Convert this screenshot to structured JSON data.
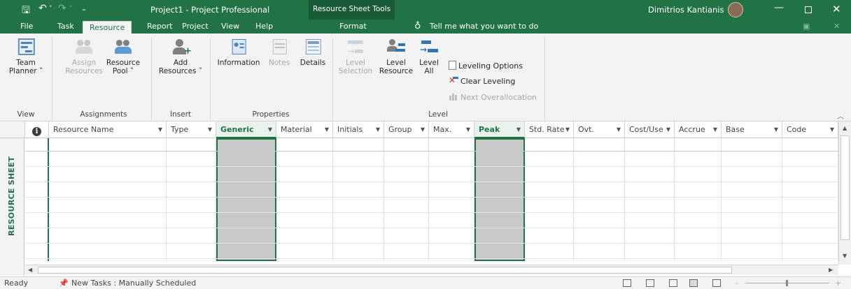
{
  "window": {
    "title": "Project1  -  Project Professional",
    "context_tab_group": "Resource Sheet Tools",
    "user_name": "Dimitrios Kantianis"
  },
  "tabs": [
    "File",
    "Task",
    "Resource",
    "Report",
    "Project",
    "View",
    "Help",
    "Format"
  ],
  "active_tab": "Resource",
  "tell_me": "Tell me what you want to do",
  "ribbon": {
    "view": {
      "team_planner": "Team",
      "team_planner_2": "Planner ˅",
      "label": "View"
    },
    "assignments": {
      "assign": "Assign",
      "assign_2": "Resources",
      "pool": "Resource",
      "pool_2": "Pool ˅",
      "label": "Assignments"
    },
    "insert": {
      "add": "Add",
      "add_2": "Resources ˅",
      "label": "Insert"
    },
    "properties": {
      "information": "Information",
      "notes": "Notes",
      "details": "Details",
      "label": "Properties"
    },
    "level": {
      "selection": "Level",
      "selection_2": "Selection",
      "resource": "Level",
      "resource_2": "Resource",
      "all": "Level",
      "all_2": "All",
      "options": "Leveling Options",
      "clear": "Clear Leveling",
      "next": "Next Overallocation",
      "label": "Level"
    }
  },
  "side_label": "RESOURCE SHEET",
  "columns": [
    "Resource Name",
    "Type",
    "Generic",
    "Material",
    "Initials",
    "Group",
    "Max.",
    "Peak",
    "Std. Rate",
    "Ovt.",
    "Cost/Use",
    "Accrue",
    "Base",
    "Code"
  ],
  "status": {
    "ready": "Ready",
    "new_tasks": "New Tasks : Manually Scheduled"
  },
  "colors": {
    "accent": "#217346",
    "context": "#185c37"
  }
}
